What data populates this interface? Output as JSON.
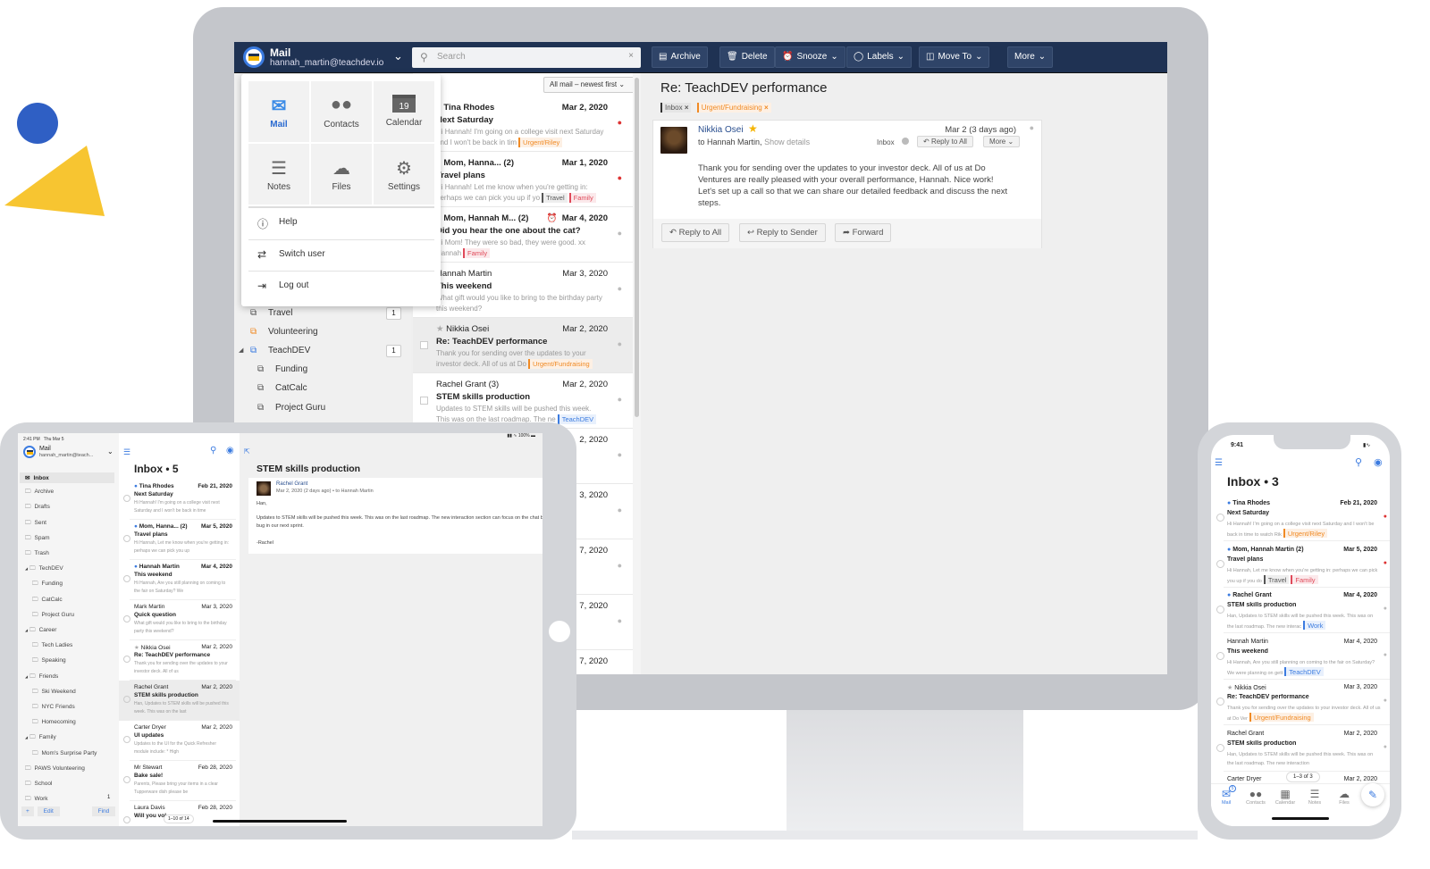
{
  "colors": {
    "brand_navy": "#1f3253",
    "accent_blue": "#3b7be0",
    "tag_orange": "#f08a24",
    "tag_red": "#e04a5a",
    "decor_blue": "#2f5fc4",
    "decor_yellow": "#f7c531"
  },
  "desktop": {
    "account": {
      "app": "Mail",
      "email": "hannah_martin@teachdev.io"
    },
    "search": {
      "placeholder": "Search"
    },
    "toolbar": [
      {
        "label": "Archive",
        "icon": "archive-icon"
      },
      {
        "label": "Delete",
        "icon": "trash-icon"
      },
      {
        "label": "Snooze",
        "icon": "alarm-icon",
        "dropdown": true
      },
      {
        "label": "Labels",
        "icon": "tag-icon",
        "dropdown": true
      },
      {
        "label": "Move To",
        "icon": "folder-move-icon",
        "dropdown": true
      },
      {
        "label": "More",
        "dropdown": true
      }
    ],
    "launcher": {
      "apps": [
        {
          "label": "Mail",
          "icon": "mail-icon",
          "active": true
        },
        {
          "label": "Contacts",
          "icon": "contacts-icon"
        },
        {
          "label": "Calendar",
          "icon": "calendar-icon",
          "day": "19"
        },
        {
          "label": "Notes",
          "icon": "notes-icon"
        },
        {
          "label": "Files",
          "icon": "cloud-icon"
        },
        {
          "label": "Settings",
          "icon": "gear-icon"
        }
      ],
      "items": [
        {
          "label": "Help",
          "icon": "help-icon"
        },
        {
          "label": "Switch user",
          "icon": "switch-icon"
        },
        {
          "label": "Log out",
          "icon": "logout-icon"
        }
      ]
    },
    "sidebar": [
      {
        "label": "Travel",
        "count": "1"
      },
      {
        "label": "Volunteering",
        "color": "orange"
      },
      {
        "label": "TeachDEV",
        "count": "1",
        "color": "blue",
        "expanded": true
      },
      {
        "label": "Funding",
        "sub": true
      },
      {
        "label": "CatCalc",
        "sub": true
      },
      {
        "label": "Project Guru",
        "sub": true
      }
    ],
    "sort": "All mail – newest first",
    "messages": [
      {
        "sender": "Tina Rhodes",
        "date": "Mar 2, 2020",
        "subject": "Next Saturday",
        "snippet": "Hi Hannah! I'm going on a college visit next Saturday and I won't be back in tim",
        "tags": [
          {
            "label": "Urgent/Riley",
            "color": "orange"
          }
        ],
        "unread": true,
        "pinned": true
      },
      {
        "sender": "Mom, Hanna...  (2)",
        "date": "Mar 1, 2020",
        "subject": "Travel plans",
        "snippet": "Hi Hannah! Let me know when you're getting in: perhaps we can pick you up if yo",
        "tags": [
          {
            "label": "Travel",
            "color": "gray"
          },
          {
            "label": "Family",
            "color": "red"
          }
        ],
        "unread": true,
        "pinned": true
      },
      {
        "sender": "Mom, Hannah M...  (2)",
        "date": "Mar 4, 2020",
        "snoozed": true,
        "subject": "Did you hear the one about the cat?",
        "snippet": "Hi Mom! They were so bad, they were good. xx Hannah",
        "tags": [
          {
            "label": "Family",
            "color": "red"
          }
        ],
        "unread": true
      },
      {
        "sender": "Hannah Martin",
        "date": "Mar 3, 2020",
        "subject": "This weekend",
        "snippet": "What gift would you like to bring to the birthday party this weekend?",
        "tags": []
      },
      {
        "sender": "Nikkia Osei",
        "starred": true,
        "date": "Mar 2, 2020",
        "subject": "Re: TeachDEV performance",
        "snippet": "Thank you for sending over the updates to your investor deck. All of us at Do",
        "tags": [
          {
            "label": "Urgent/Fundraising",
            "color": "orange"
          }
        ],
        "selected": true
      },
      {
        "sender": "Rachel Grant (3)",
        "date": "Mar 2, 2020",
        "subject": "STEM skills production",
        "snippet": "Updates to STEM skills will be pushed this week. This was on the last roadmap. The ne",
        "tags": [
          {
            "label": "TeachDEV",
            "color": "blue"
          }
        ]
      },
      {
        "sender": "",
        "date": "2, 2020",
        "subject": "",
        "snippet": "module",
        "tags": [
          {
            "label": "achDEV",
            "color": "blue"
          }
        ]
      },
      {
        "sender": "",
        "date": "3, 2020",
        "subject": "",
        "snippet": "",
        "tags": [
          {
            "label": "teering",
            "color": "orange"
          }
        ]
      },
      {
        "sender": "",
        "date": "7, 2020",
        "subject": "",
        "snippet": "needs",
        "tags": [
          {
            "label": "teering",
            "color": "orange"
          }
        ]
      },
      {
        "sender": "",
        "date": "7, 2020",
        "subject": "",
        "snippet": "ek,",
        "tags": []
      },
      {
        "sender": "",
        "date": "7, 2020",
        "subject": "",
        "snippet": "",
        "tags": []
      }
    ],
    "reading": {
      "title": "Re: TeachDEV performance",
      "tags": [
        {
          "label": "Inbox",
          "color": "gray"
        },
        {
          "label": "Urgent/Fundraising",
          "color": "orange"
        }
      ],
      "from": "Nikkia Osei",
      "to": "to Hannah Martin,",
      "show_details": "Show details",
      "date": "Mar 2 (3 days ago)",
      "folder": "Inbox",
      "reply_all_small": "Reply to All",
      "more": "More",
      "body": "Thank you for sending over the updates to your investor deck. All of us at Do Ventures are really pleased with your overall performance, Hannah. Nice work! Let's set up a call so that we can share our detailed feedback and discuss the next steps.",
      "actions": [
        "Reply to All",
        "Reply to Sender",
        "Forward"
      ]
    }
  },
  "tablet": {
    "status": {
      "time": "2:41 PM",
      "date": "Thu Mar 5",
      "battery": "100%"
    },
    "account": {
      "app": "Mail",
      "email": "hannah_martin@teach..."
    },
    "folders": [
      {
        "label": "Inbox",
        "selected": true
      },
      {
        "label": "Archive"
      },
      {
        "label": "Drafts"
      },
      {
        "label": "Sent"
      },
      {
        "label": "Spam"
      },
      {
        "label": "Trash"
      },
      {
        "label": "TechDEV",
        "group": true
      },
      {
        "label": "Funding",
        "sub": true
      },
      {
        "label": "CatCalc",
        "sub": true
      },
      {
        "label": "Project Guru",
        "sub": true
      },
      {
        "label": "Career",
        "group": true
      },
      {
        "label": "Tech Ladies",
        "sub": true
      },
      {
        "label": "Speaking",
        "sub": true
      },
      {
        "label": "Friends",
        "group": true
      },
      {
        "label": "Ski Weekend",
        "sub": true
      },
      {
        "label": "NYC Friends",
        "sub": true
      },
      {
        "label": "Homecoming",
        "sub": true
      },
      {
        "label": "Family",
        "group": true
      },
      {
        "label": "Mom's Surprise Party",
        "sub": true
      },
      {
        "label": "PAWS Volunteering"
      },
      {
        "label": "School"
      },
      {
        "label": "Work",
        "count": "1"
      }
    ],
    "footer": {
      "add": "+",
      "edit": "Edit",
      "find": "Find"
    },
    "inbox_title": "Inbox • 5",
    "messages": [
      {
        "sender": "Tina Rhodes",
        "date": "Feb 21, 2020",
        "subject": "Next Saturday",
        "snippet": "Hi Hannah! I'm going on a college visit next Saturday and I won't be back in time",
        "unread": true
      },
      {
        "sender": "Mom, Hanna...  (2)",
        "date": "Mar 5, 2020",
        "subject": "Travel plans",
        "snippet": "Hi Hannah, Let me know when you're getting in: perhaps we can pick you up",
        "unread": true
      },
      {
        "sender": "Hannah Martin",
        "date": "Mar 4, 2020",
        "subject": "This weekend",
        "snippet": "Hi Hannah, Are you still planning on coming to the fair on Saturday? We",
        "unread": true
      },
      {
        "sender": "Mark Martin",
        "date": "Mar 3, 2020",
        "subject": "Quick question",
        "snippet": "What gift would you like to bring to the birthday party this weekend?"
      },
      {
        "sender": "Nikkia Osei",
        "starred": true,
        "date": "Mar 2, 2020",
        "subject": "Re: TeachDEV performance",
        "snippet": "Thank you for sending over the updates to your investor deck. All of us"
      },
      {
        "sender": "Rachel Grant",
        "date": "Mar 2, 2020",
        "subject": "STEM skills production",
        "snippet": "Han, Updates to STEM skills will be pushed this week. This was on the last",
        "selected": true
      },
      {
        "sender": "Carter Dryer",
        "date": "Mar 2, 2020",
        "subject": "UI updates",
        "snippet": "Updates to the UI for the Quick Refresher module include: * High"
      },
      {
        "sender": "Mr Stewart",
        "date": "Feb 28, 2020",
        "subject": "Bake sale!",
        "snippet": "Parents, Please bring your items in a clear Tupperware dish please be"
      },
      {
        "sender": "Laura Davis",
        "date": "Feb 28, 2020",
        "subject": "Will you vol",
        "snippet": ""
      }
    ],
    "pager": "1–10 of 14",
    "reading": {
      "title": "STEM skills production",
      "from": "Rachel Grant",
      "meta": "Mar 2, 2020 (2 days ago) • to Hannah Martin",
      "greeting": "Han,",
      "body": "Updates to STEM skills will be pushed this week. This was on the last roadmap. The new interaction section can focus on the chat box bug in our next sprint.",
      "signoff": "-Rachel"
    }
  },
  "phone": {
    "status": {
      "time": "9:41"
    },
    "inbox_title": "Inbox • 3",
    "messages": [
      {
        "sender": "Tina Rhodes",
        "date": "Feb 21, 2020",
        "subject": "Next Saturday",
        "snippet": "Hi Hannah! I'm going on a college visit next Saturday and I won't be back in time to watch Rik",
        "tags": [
          {
            "label": "Urgent/Riley",
            "color": "orange"
          }
        ],
        "unread": true,
        "pinned": true
      },
      {
        "sender": "Mom, Hannah Martin (2)",
        "date": "Mar 5, 2020",
        "subject": "Travel plans",
        "snippet": "Hi Hannah, Let me know when you're getting in: perhaps we can pick you up if you do",
        "tags": [
          {
            "label": "Travel",
            "color": "gray"
          },
          {
            "label": "Family",
            "color": "red"
          }
        ],
        "unread": true,
        "pinned": true
      },
      {
        "sender": "Rachel Grant",
        "date": "Mar 4, 2020",
        "subject": "STEM skills production",
        "snippet": "Han, Updates to STEM skills will be pushed this week. This was on the last roadmap. The new interac",
        "tags": [
          {
            "label": "Work",
            "color": "blue"
          }
        ],
        "unread": true
      },
      {
        "sender": "Hannah Martin",
        "date": "Mar 4, 2020",
        "subject": "This weekend",
        "snippet": "Hi Hannah, Are you still planning on coming to the fair on Saturday? We were planning on gett",
        "tags": [
          {
            "label": "TeachDEV",
            "color": "blue"
          }
        ]
      },
      {
        "sender": "Nikkia Osei",
        "starred": true,
        "date": "Mar 3, 2020",
        "subject": "Re: TeachDEV performance",
        "snippet": "Thank you for sending over the updates to your investor deck. All of us at Do Ver",
        "tags": [
          {
            "label": "Urgent/Fundraising",
            "color": "orange"
          }
        ]
      },
      {
        "sender": "Rachel Grant",
        "date": "Mar 2, 2020",
        "subject": "STEM skills production",
        "snippet": "Han, Updates to STEM skills will be pushed this week. This was on the last roadmap. The new interaction",
        "tags": []
      },
      {
        "sender": "Carter Dryer",
        "date": "Mar 2, 2020",
        "subject": "",
        "snippet": "",
        "tags": []
      }
    ],
    "pager": "1–3 of 3",
    "tabs": [
      {
        "label": "Mail",
        "icon": "mail-icon",
        "badge": "5",
        "active": true
      },
      {
        "label": "Contacts",
        "icon": "contacts-icon"
      },
      {
        "label": "Calendar",
        "icon": "calendar-icon"
      },
      {
        "label": "Notes",
        "icon": "notes-icon"
      },
      {
        "label": "Files",
        "icon": "cloud-icon"
      }
    ]
  }
}
